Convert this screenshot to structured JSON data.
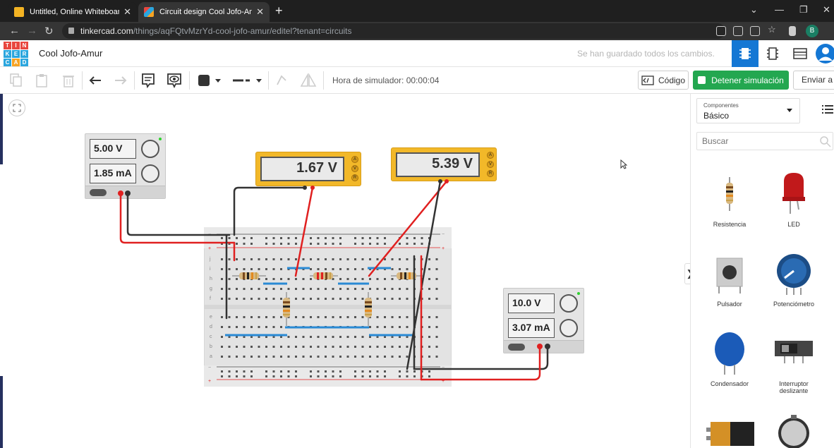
{
  "browser": {
    "tabs": [
      {
        "title": "Untitled, Online Whiteboard for \\",
        "active": false
      },
      {
        "title": "Circuit design Cool Jofo-Amur | Ti",
        "active": true
      }
    ],
    "url_host": "tinkercad.com",
    "url_path": "/things/aqFQtvMzrYd-cool-jofo-amur/editel?tenant=circuits",
    "profile_initial": "B"
  },
  "header": {
    "logo_letters": [
      "T",
      "I",
      "N",
      "K",
      "E",
      "R",
      "C",
      "A",
      "D"
    ],
    "project_name": "Cool Jofo-Amur",
    "saved_status": "Se han guardado todos los cambios."
  },
  "toolbar": {
    "sim_time_label": "Hora de simulador: 00:00:04",
    "code_label": "Código",
    "stop_label": "Detener simulación",
    "send_label": "Enviar a"
  },
  "circuit": {
    "psu_left": {
      "voltage": "5.00 V",
      "current": "1.85 mA"
    },
    "psu_right": {
      "voltage": "10.0 V",
      "current": "3.07 mA"
    },
    "mm1": {
      "reading": "1.67 V"
    },
    "mm2": {
      "reading": "5.39 V"
    },
    "mm_modes": [
      "A",
      "V",
      "R"
    ],
    "breadboard_rows_top": [
      "j",
      "i",
      "h",
      "g",
      "f"
    ],
    "breadboard_rows_bottom": [
      "e",
      "d",
      "c",
      "b",
      "a"
    ]
  },
  "sidebar": {
    "components_label": "Componentes",
    "components_value": "Básico",
    "search_placeholder": "Buscar",
    "items": [
      {
        "label": "Resistencia",
        "icon": "resistor-icon"
      },
      {
        "label": "LED",
        "icon": "led-icon"
      },
      {
        "label": "Pulsador",
        "icon": "pushbutton-icon"
      },
      {
        "label": "Potenciómetro",
        "icon": "potentiometer-icon"
      },
      {
        "label": "Condensador",
        "icon": "capacitor-icon"
      },
      {
        "label": "Interruptor deslizante",
        "icon": "slide-switch-icon"
      },
      {
        "label": "",
        "icon": "battery-9v-icon"
      },
      {
        "label": "",
        "icon": "coin-battery-icon"
      }
    ]
  },
  "colors": {
    "accent": "#1477d4",
    "stop_green": "#23a750",
    "wire_red": "#e02020",
    "wire_black": "#333333"
  }
}
